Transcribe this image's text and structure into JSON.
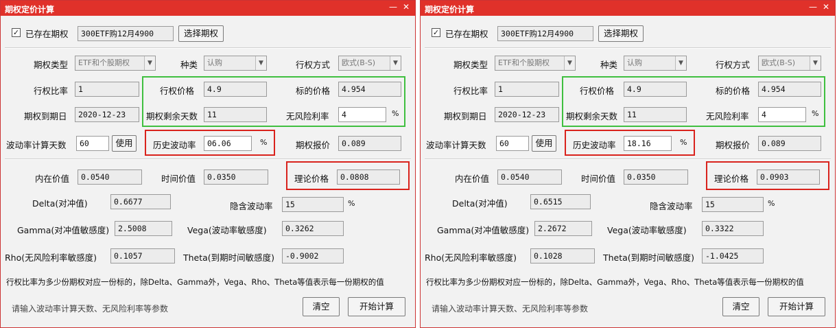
{
  "title": "期权定价计算",
  "window_controls": {
    "minimize": "—",
    "close": "✕"
  },
  "labels": {
    "existing_option": "已存在期权",
    "select_option_button": "选择期权",
    "option_type": "期权类型",
    "underlying": "种类",
    "exercise_style": "行权方式",
    "exercise_ratio": "行权比率",
    "strike_price": "行权价格",
    "underlying_price": "标的价格",
    "expiry_date": "期权到期日",
    "remaining_days": "期权剩余天数",
    "risk_free_rate": "无风险利率",
    "vol_calc_days": "波动率计算天数",
    "use_button": "使用",
    "historical_vol": "历史波动率",
    "option_quote": "期权报价",
    "intrinsic_value": "内在价值",
    "time_value": "时间价值",
    "theoretical_price": "理论价格",
    "delta": "Delta(对冲值)",
    "implied_vol": "隐含波动率",
    "gamma": "Gamma(对冲值敏感度)",
    "vega": "Vega(波动率敏感度)",
    "rho": "Rho(无风险利率敏感度)",
    "theta": "Theta(到期时间敏感度)",
    "percent": "%",
    "footnote": "行权比率为多少份期权对应一份标的，除Delta、Gamma外，Vega、Rho、Theta等值表示每一份期权的值",
    "hint": "请输入波动率计算天数、无风险利率等参数",
    "clear_button": "清空",
    "calculate_button": "开始计算"
  },
  "check_mark": "✓",
  "combo_arrow": "▼",
  "windows": [
    {
      "option_name": "300ETF购12月4900",
      "option_type": "ETF和个股期权",
      "underlying": "认购",
      "exercise_style": "欧式(B-S)",
      "exercise_ratio": "1",
      "strike_price": "4.9",
      "underlying_price": "4.954",
      "expiry_date": "2020-12-23",
      "remaining_days": "11",
      "risk_free_rate": "4",
      "vol_calc_days": "60",
      "historical_vol": "06.06",
      "option_quote": "0.089",
      "intrinsic_value": "0.0540",
      "time_value": "0.0350",
      "theoretical_price": "0.0808",
      "delta": "0.6677",
      "implied_vol": "15",
      "gamma": "2.5008",
      "vega": "0.3262",
      "rho": "0.1057",
      "theta": "-0.9002"
    },
    {
      "option_name": "300ETF购12月4900",
      "option_type": "ETF和个股期权",
      "underlying": "认购",
      "exercise_style": "欧式(B-S)",
      "exercise_ratio": "1",
      "strike_price": "4.9",
      "underlying_price": "4.954",
      "expiry_date": "2020-12-23",
      "remaining_days": "11",
      "risk_free_rate": "4",
      "vol_calc_days": "60",
      "historical_vol": "18.16",
      "option_quote": "0.089",
      "intrinsic_value": "0.0540",
      "time_value": "0.0350",
      "theoretical_price": "0.0903",
      "delta": "0.6515",
      "implied_vol": "15",
      "gamma": "2.2672",
      "vega": "0.3322",
      "rho": "0.1028",
      "theta": "-1.0425"
    }
  ]
}
